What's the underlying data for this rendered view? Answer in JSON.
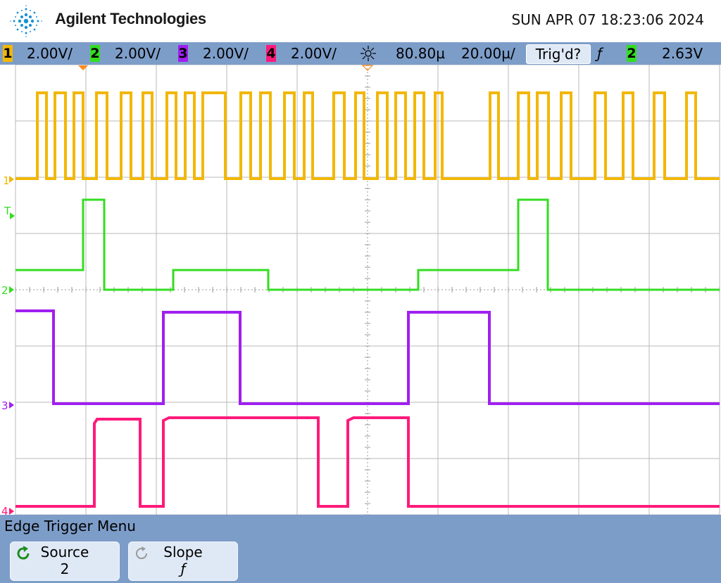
{
  "header": {
    "brand": "Agilent Technologies",
    "datetime": "SUN APR 07 18:23:06 2024"
  },
  "status": {
    "channels": [
      {
        "num": "1",
        "scale": "2.00V/",
        "color": "#f2b705"
      },
      {
        "num": "2",
        "scale": "2.00V/",
        "color": "#33dd22"
      },
      {
        "num": "3",
        "scale": "2.00V/",
        "color": "#a020f0"
      },
      {
        "num": "4",
        "scale": "2.00V/",
        "color": "#ff1a7a"
      }
    ],
    "delay": "80.80µ",
    "timebase": "20.00µ/",
    "trigger_status": "Trig'd?",
    "trigger_slope_symbol": "ƒ",
    "trigger_source": "2",
    "trigger_level": "2.63V",
    "icons": {
      "delay": "sun-icon",
      "slope": "rising-edge-icon"
    }
  },
  "markers": {
    "ch1": "1",
    "trigger": "T",
    "ch2": "2",
    "ch3": "3",
    "ch4": "4"
  },
  "menu": {
    "title": "Edge Trigger Menu",
    "softkeys": [
      {
        "label": "Source",
        "value": "2",
        "icon": "refresh-icon",
        "active": true
      },
      {
        "label": "Slope",
        "value": "ƒ",
        "icon": "refresh-icon",
        "active": false
      }
    ]
  },
  "colors": {
    "ch1": "#f2b705",
    "ch2": "#33dd22",
    "ch3": "#a020f0",
    "ch4": "#ff1a7a",
    "bar": "#7d9dc9",
    "grid": "#b8b8b8"
  }
}
